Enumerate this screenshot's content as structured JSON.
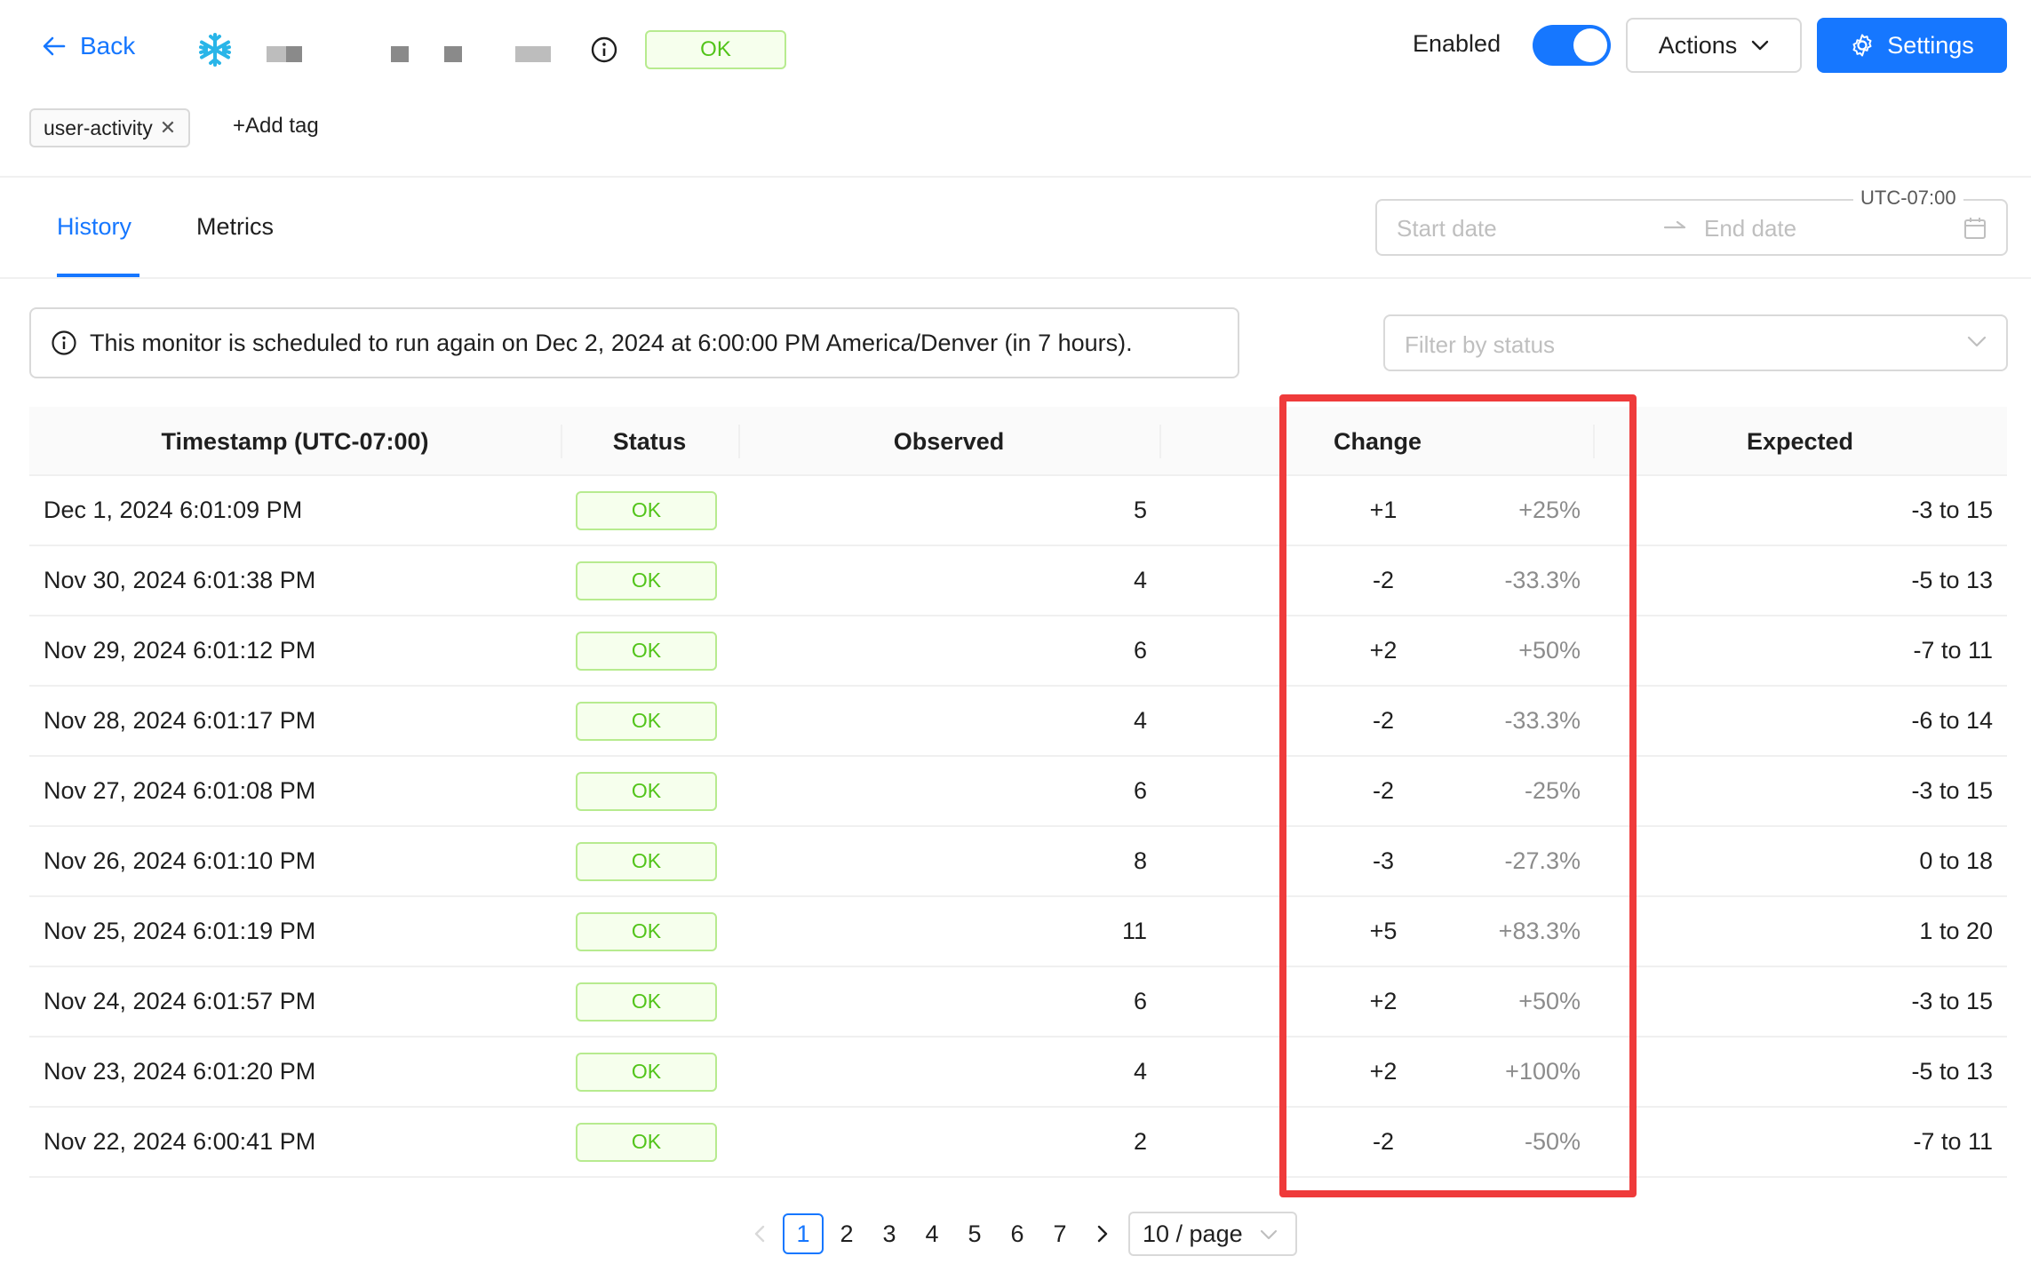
{
  "header": {
    "back_label": "Back",
    "status_badge": "OK",
    "enabled_label": "Enabled",
    "enabled": true,
    "actions_label": "Actions",
    "settings_label": "Settings"
  },
  "tags": {
    "items": [
      {
        "label": "user-activity"
      }
    ],
    "add_label": "+Add tag"
  },
  "tabs": [
    {
      "label": "History",
      "active": true
    },
    {
      "label": "Metrics",
      "active": false
    }
  ],
  "date_range": {
    "timezone": "UTC-07:00",
    "start_placeholder": "Start date",
    "end_placeholder": "End date"
  },
  "notice": {
    "text": "This monitor is scheduled to run again on Dec 2, 2024 at 6:00:00 PM America/Denver (in 7 hours)."
  },
  "filter": {
    "placeholder": "Filter by status"
  },
  "table": {
    "columns": {
      "timestamp": "Timestamp (UTC-07:00)",
      "status": "Status",
      "observed": "Observed",
      "change": "Change",
      "expected": "Expected"
    },
    "rows": [
      {
        "timestamp": "Dec 1, 2024 6:01:09 PM",
        "status": "OK",
        "observed": "5",
        "change": "+1",
        "change_pct": "+25%",
        "expected": "-3 to 15"
      },
      {
        "timestamp": "Nov 30, 2024 6:01:38 PM",
        "status": "OK",
        "observed": "4",
        "change": "-2",
        "change_pct": "-33.3%",
        "expected": "-5 to 13"
      },
      {
        "timestamp": "Nov 29, 2024 6:01:12 PM",
        "status": "OK",
        "observed": "6",
        "change": "+2",
        "change_pct": "+50%",
        "expected": "-7 to 11"
      },
      {
        "timestamp": "Nov 28, 2024 6:01:17 PM",
        "status": "OK",
        "observed": "4",
        "change": "-2",
        "change_pct": "-33.3%",
        "expected": "-6 to 14"
      },
      {
        "timestamp": "Nov 27, 2024 6:01:08 PM",
        "status": "OK",
        "observed": "6",
        "change": "-2",
        "change_pct": "-25%",
        "expected": "-3 to 15"
      },
      {
        "timestamp": "Nov 26, 2024 6:01:10 PM",
        "status": "OK",
        "observed": "8",
        "change": "-3",
        "change_pct": "-27.3%",
        "expected": "0 to 18"
      },
      {
        "timestamp": "Nov 25, 2024 6:01:19 PM",
        "status": "OK",
        "observed": "11",
        "change": "+5",
        "change_pct": "+83.3%",
        "expected": "1 to 20"
      },
      {
        "timestamp": "Nov 24, 2024 6:01:57 PM",
        "status": "OK",
        "observed": "6",
        "change": "+2",
        "change_pct": "+50%",
        "expected": "-3 to 15"
      },
      {
        "timestamp": "Nov 23, 2024 6:01:20 PM",
        "status": "OK",
        "observed": "4",
        "change": "+2",
        "change_pct": "+100%",
        "expected": "-5 to 13"
      },
      {
        "timestamp": "Nov 22, 2024 6:00:41 PM",
        "status": "OK",
        "observed": "2",
        "change": "-2",
        "change_pct": "-50%",
        "expected": "-7 to 11"
      }
    ]
  },
  "pagination": {
    "pages": [
      "1",
      "2",
      "3",
      "4",
      "5",
      "6",
      "7"
    ],
    "current": "1",
    "page_size": "10 / page"
  },
  "colors": {
    "primary": "#1677ff",
    "ok_text": "#52c41a",
    "ok_bg": "#f6ffed",
    "highlight": "#ef3b3b"
  }
}
